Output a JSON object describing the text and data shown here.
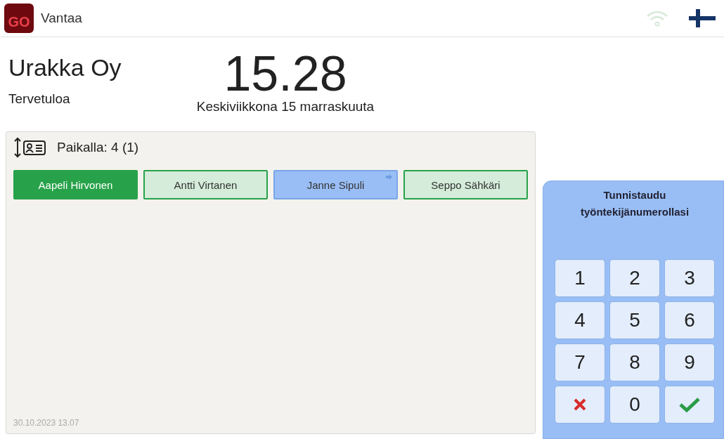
{
  "header": {
    "logo": "GO",
    "location": "Vantaa"
  },
  "company": {
    "name": "Urakka Oy",
    "greeting": "Tervetuloa"
  },
  "clock": {
    "time": "15.28",
    "date": "Keskiviikkona 15 marraskuuta"
  },
  "presence": {
    "label": "Paikalla: 4 (1)",
    "employees": [
      {
        "name": "Aapeli Hirvonen",
        "kind": "active"
      },
      {
        "name": "Antti Virtanen",
        "kind": "present"
      },
      {
        "name": "Janne Sipuli",
        "kind": "away"
      },
      {
        "name": "Seppo Sähkäri",
        "kind": "present"
      }
    ],
    "timestamp": "30.10.2023  13.07"
  },
  "keypad": {
    "prompt": "Tunnistaudu työntekijänumerollasi",
    "keys": [
      {
        "kind": "digit",
        "label": "1"
      },
      {
        "kind": "digit",
        "label": "2"
      },
      {
        "kind": "digit",
        "label": "3"
      },
      {
        "kind": "digit",
        "label": "4"
      },
      {
        "kind": "digit",
        "label": "5"
      },
      {
        "kind": "digit",
        "label": "6"
      },
      {
        "kind": "digit",
        "label": "7"
      },
      {
        "kind": "digit",
        "label": "8"
      },
      {
        "kind": "digit",
        "label": "9"
      },
      {
        "kind": "cancel"
      },
      {
        "kind": "digit",
        "label": "0"
      },
      {
        "kind": "confirm"
      }
    ]
  }
}
